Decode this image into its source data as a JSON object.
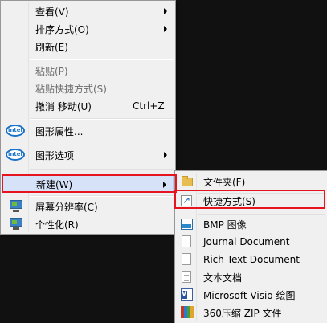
{
  "context_menu": {
    "items": [
      {
        "label": "查看(V)",
        "enabled": true,
        "submenu": true
      },
      {
        "label": "排序方式(O)",
        "enabled": true,
        "submenu": true
      },
      {
        "label": "刷新(E)",
        "enabled": true
      },
      {
        "label": "粘贴(P)",
        "enabled": false
      },
      {
        "label": "粘贴快捷方式(S)",
        "enabled": false
      },
      {
        "label": "撤消 移动(U)",
        "shortcut": "Ctrl+Z",
        "enabled": true
      },
      {
        "label": "图形属性...",
        "icon": "intel-graphics-icon",
        "enabled": true
      },
      {
        "label": "图形选项",
        "icon": "intel-graphics-icon",
        "enabled": true,
        "submenu": true
      },
      {
        "label": "新建(W)",
        "enabled": true,
        "submenu": true,
        "highlighted": true
      },
      {
        "label": "屏幕分辨率(C)",
        "icon": "monitor-icon",
        "enabled": true
      },
      {
        "label": "个性化(R)",
        "icon": "monitor-icon",
        "enabled": true
      }
    ],
    "intel_badge": "intel"
  },
  "new_submenu": {
    "items": [
      {
        "label": "文件夹(F)",
        "icon": "folder-icon"
      },
      {
        "label": "快捷方式(S)",
        "icon": "shortcut-icon"
      },
      {
        "label": "BMP 图像",
        "icon": "bitmap-image-icon"
      },
      {
        "label": "Journal Document",
        "icon": "document-icon"
      },
      {
        "label": "Rich Text Document",
        "icon": "document-icon"
      },
      {
        "label": "文本文档",
        "icon": "text-document-icon"
      },
      {
        "label": "Microsoft Visio 绘图",
        "icon": "visio-icon"
      },
      {
        "label": "360压缩 ZIP 文件",
        "icon": "zip-archive-icon"
      }
    ]
  },
  "colors": {
    "menu_bg": "#f0f0f0",
    "highlight": "#d5e2f8",
    "annotation_box": "#e6141e",
    "desktop": "#111111"
  }
}
